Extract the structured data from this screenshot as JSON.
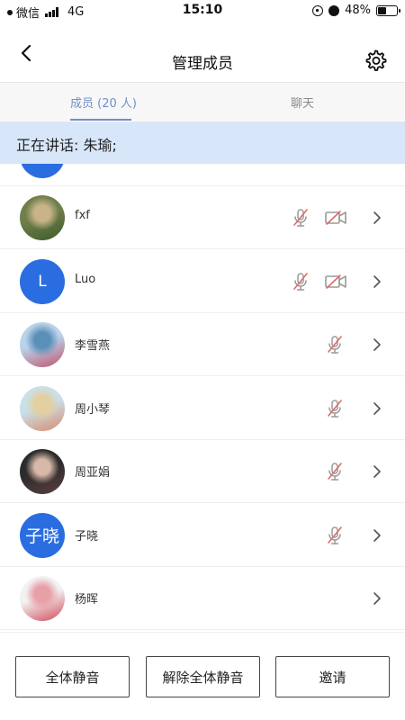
{
  "status_bar": {
    "carrier": "微信",
    "network": "4G",
    "time": "15:10",
    "battery": "48%",
    "battery_level": 0.48
  },
  "header": {
    "title": "管理成员",
    "back_icon": "chevron-left-icon",
    "settings_icon": "gear-icon"
  },
  "tabs": {
    "members": "成员 (20 人)",
    "chat": "聊天"
  },
  "banner": {
    "text": "正在讲话: 朱瑜;"
  },
  "members": [
    {
      "name": "fxf",
      "avatar_type": "photo",
      "avatar_colors": [
        "#6f7f4a",
        "#c9b48a",
        "#3f5a2e"
      ],
      "mic_muted": true,
      "camera_off": true
    },
    {
      "name": "Luo",
      "avatar_type": "letter",
      "avatar_text": "L",
      "avatar_color": "#2a6de0",
      "mic_muted": true,
      "camera_off": true
    },
    {
      "name": "李雪燕",
      "avatar_type": "photo",
      "avatar_colors": [
        "#b9d3ea",
        "#5a8fb8",
        "#c0546b"
      ],
      "mic_muted": true,
      "camera_off": false
    },
    {
      "name": "周小琴",
      "avatar_type": "photo",
      "avatar_colors": [
        "#c9e0ea",
        "#e4cfa0",
        "#d98a6a"
      ],
      "mic_muted": true,
      "camera_off": false
    },
    {
      "name": "周亚娟",
      "avatar_type": "photo",
      "avatar_colors": [
        "#2b2b2b",
        "#d8b8a8",
        "#5a4040"
      ],
      "mic_muted": true,
      "camera_off": false
    },
    {
      "name": "子晓",
      "avatar_type": "letter",
      "avatar_text": "子晓",
      "avatar_color": "#2a6de0",
      "mic_muted": true,
      "camera_off": false
    },
    {
      "name": "杨晖",
      "avatar_type": "photo",
      "avatar_colors": [
        "#f2f2f2",
        "#e8a0a8",
        "#d04a5a"
      ],
      "mic_muted": false,
      "camera_off": false
    }
  ],
  "footer": {
    "mute_all": "全体静音",
    "unmute_all": "解除全体静音",
    "invite": "邀请"
  },
  "colors": {
    "accent": "#6f90c9",
    "banner_bg": "#d7e6f8",
    "muted_icon_red": "#e06a6a",
    "icon_gray": "#9a9a9a"
  }
}
